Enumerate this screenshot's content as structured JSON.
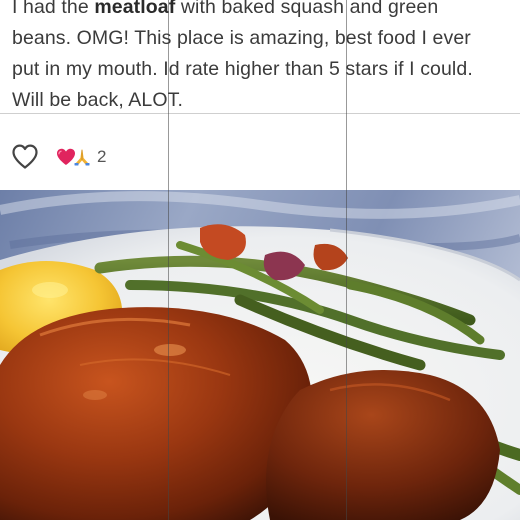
{
  "review": {
    "line1_pre": "I had the ",
    "line1_bold": "meatloaf",
    "line1_post": " with baked squash and green",
    "line2": "beans. OMG! This place is amazing, best food I ever",
    "line3": "put in my mouth. Id rate higher than 5 stars if I could.",
    "line4": "Will be back, ALOT."
  },
  "actions": {
    "like_icon": "heart-outline-icon",
    "reaction_icons": [
      "red-heart-emoji",
      "folded-hands-emoji"
    ],
    "reaction_count": "2"
  },
  "photo": {
    "subject": "meatloaf-with-green-beans-and-squash"
  },
  "colors": {
    "text": "#3b3b3b",
    "divider": "#cfcfcf",
    "heart_red": "#e0245e",
    "background": "#ffffff"
  }
}
